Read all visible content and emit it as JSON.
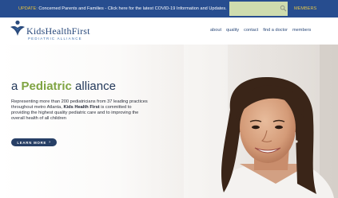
{
  "topbar": {
    "update_tag": "UPDATE:",
    "message": " Concerned Parents and Families - Click here for the latest COVID-19 Information and Updates.",
    "search_placeholder": "",
    "members_label": "MEMBERS"
  },
  "logo": {
    "name": "KidsHealthFirst",
    "tagline": "PEDIATRIC ALLIANCE"
  },
  "nav": {
    "items": [
      "about",
      "quality",
      "contact",
      "find a doctor",
      "members"
    ]
  },
  "hero": {
    "title_prefix": "a ",
    "title_accent": "Pediatric",
    "title_suffix": " alliance",
    "copy_part1": "Representing more than 200 pediatricians from 37 leading practices throughout metro Atlanta, ",
    "copy_bold": "Kids Health First",
    "copy_part2": " is committed to providing the highest quality pediatric care and to improving the overall health of all children",
    "cta_label": "LEARN MORE",
    "cta_chevron": "›"
  },
  "colors": {
    "topbar_bg": "#274d8f",
    "search_bg": "#cfdcae",
    "members_gold": "#e2c44a",
    "brand_navy": "#23385a",
    "brand_green": "#7fa442",
    "cta_bg": "#273f66"
  },
  "icons": {
    "search": "search-icon",
    "logo_mark": "logo-mark-icon"
  }
}
